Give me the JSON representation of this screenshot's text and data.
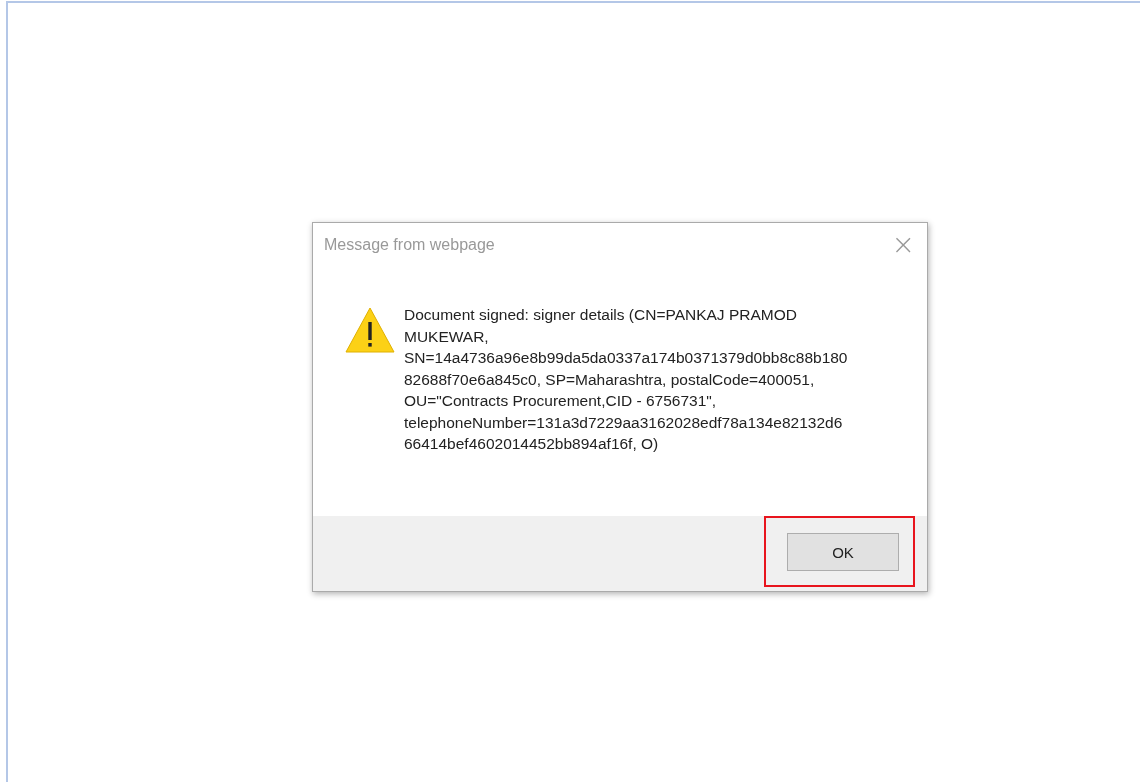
{
  "dialog": {
    "title": "Message from webpage",
    "close": "×",
    "icon": {
      "kind": "warning"
    },
    "message": "Document signed: signer details (CN=PANKAJ PRAMOD\nMUKEWAR,\nSN=14a4736a96e8b99da5da0337a174b0371379d0bb8c88b180\n82688f70e6a845c0, SP=Maharashtra, postalCode=400051,\nOU=\"Contracts Procurement,CID - 6756731\",\ntelephoneNumber=131a3d7229aa3162028edf78a134e82132d6\n66414bef4602014452bb894af16f, O)",
    "buttons": [
      {
        "label": "OK",
        "highlighted": true
      }
    ]
  }
}
